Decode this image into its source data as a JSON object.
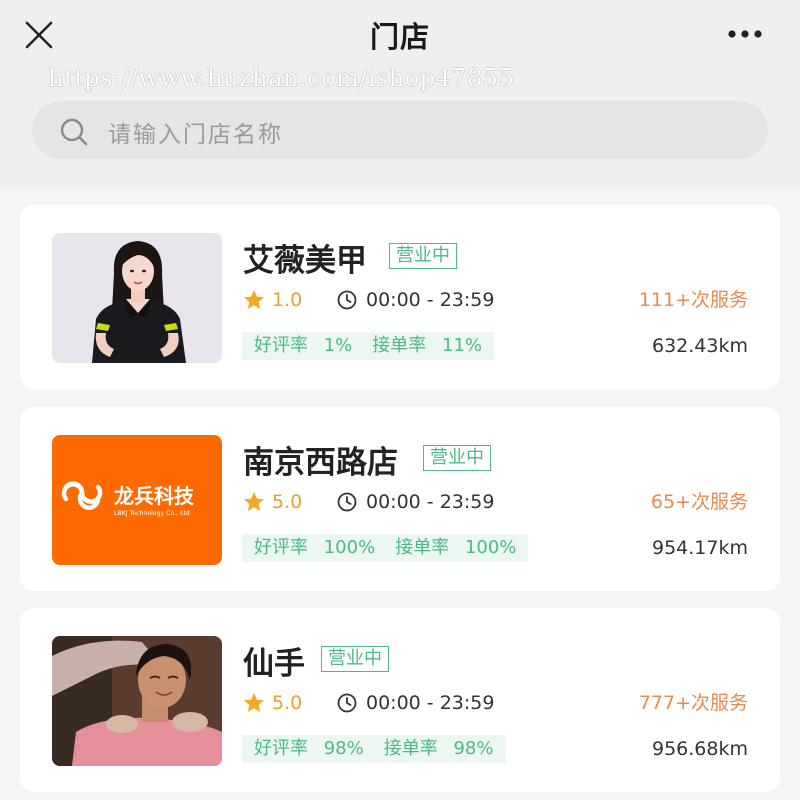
{
  "nav": {
    "title": "门店",
    "close_icon": "close-icon",
    "more_icon": "more-horizontal-icon"
  },
  "watermark": "https://www.huzhan.com/ishop47855",
  "search": {
    "placeholder": "请输入门店名称",
    "icon": "search-icon"
  },
  "colors": {
    "accent_green": "#4cba86",
    "rating_orange": "#e7a12d",
    "service_orange": "#e98b4e",
    "logo_orange": "#ff6a00"
  },
  "stores": [
    {
      "name": "艾薇美甲",
      "status": "营业中",
      "rating": "1.0",
      "hours": "00:00 - 23:59",
      "service_count": "111+次服务",
      "good_rate_label": "好评率",
      "good_rate": "1%",
      "accept_rate_label": "接单率",
      "accept_rate": "11%",
      "distance": "632.43km",
      "image": "woman-portrait-photo"
    },
    {
      "name": "南京西路店",
      "status": "营业中",
      "rating": "5.0",
      "hours": "00:00 - 23:59",
      "service_count": "65+次服务",
      "good_rate_label": "好评率",
      "good_rate": "100%",
      "accept_rate_label": "接单率",
      "accept_rate": "100%",
      "distance": "954.17km",
      "image": "longbing-logo",
      "logo_text": "龙兵科技",
      "logo_subtext": "LBKJ Technology Co., Ltd"
    },
    {
      "name": "仙手",
      "status": "营业中",
      "rating": "5.0",
      "hours": "00:00 - 23:59",
      "service_count": "777+次服务",
      "good_rate_label": "好评率",
      "good_rate": "98%",
      "accept_rate_label": "接单率",
      "accept_rate": "98%",
      "distance": "956.68km",
      "image": "massage-photo"
    }
  ]
}
